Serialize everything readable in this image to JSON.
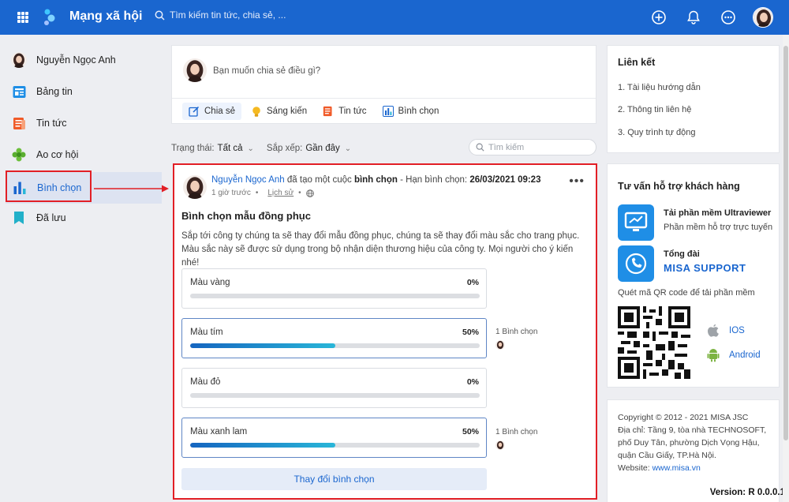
{
  "topbar": {
    "title": "Mạng xã hội",
    "search_placeholder": "Tìm kiếm tin tức, chia sẻ, ..."
  },
  "sidebar": {
    "user_name": "Nguyễn Ngọc Anh",
    "items": [
      {
        "label": "Bảng tin",
        "icon": "newsfeed-icon"
      },
      {
        "label": "Tin tức",
        "icon": "news-icon"
      },
      {
        "label": "Ao cơ hội",
        "icon": "opportunity-icon"
      },
      {
        "label": "Bình chọn",
        "icon": "poll-icon",
        "active": true
      },
      {
        "label": "Đã lưu",
        "icon": "bookmark-icon"
      }
    ]
  },
  "composer": {
    "placeholder": "Bạn muốn chia sẻ điều gì?",
    "actions": [
      "Chia sẻ",
      "Sáng kiến",
      "Tin tức",
      "Bình chọn"
    ]
  },
  "filters": {
    "status_label": "Trạng thái:",
    "status_value": "Tất cả",
    "sort_label": "Sắp xếp:",
    "sort_value": "Gần đây",
    "search_placeholder": "Tìm kiếm"
  },
  "post": {
    "author": "Nguyễn Ngọc Anh",
    "action": "đã tạo một cuộc",
    "type": "bình chọn",
    "deadline_label": "- Hạn bình chọn:",
    "deadline": "26/03/2021 09:23",
    "time": "1 giờ trước",
    "history": "Lịch sử",
    "dot": "•",
    "more": "•••",
    "title": "Bình chọn mẫu đồng phục",
    "description": "Sắp tới công ty chúng ta sẽ thay đổi mẫu đồng phục, chúng ta sẽ thay đổi màu sắc cho trang phục. Màu sắc này sẽ được sử dụng trong bộ nhận diện thương hiệu của công ty. Mọi người cho ý kiến nhé!",
    "options": [
      {
        "label": "Màu vàng",
        "percent": "0%",
        "fraction": 0,
        "voted": false,
        "votes": ""
      },
      {
        "label": "Màu tím",
        "percent": "50%",
        "fraction": 0.5,
        "voted": true,
        "votes": "1 Bình chọn"
      },
      {
        "label": "Màu đỏ",
        "percent": "0%",
        "fraction": 0,
        "voted": false,
        "votes": ""
      },
      {
        "label": "Màu xanh lam",
        "percent": "50%",
        "fraction": 0.5,
        "voted": true,
        "votes": "1 Bình chọn"
      }
    ],
    "change_button": "Thay đổi bình chọn"
  },
  "links": {
    "title": "Liên kết",
    "items": [
      "1. Tài liệu hướng dẫn",
      "2. Thông tin liên hệ",
      "3. Quy trình tự động"
    ]
  },
  "support": {
    "title": "Tư vấn hỗ trợ khách hàng",
    "ultraviewer_title": "Tải phần mềm Ultraviewer",
    "ultraviewer_sub": "Phần mềm hỗ trợ trực tuyến",
    "hotline_title": "Tổng đài",
    "hotline_name": "MISA SUPPORT",
    "qr_caption": "Quét mã QR code để tải phần mềm",
    "ios": "IOS",
    "android": "Android"
  },
  "footer": {
    "copyright": "Copyright © 2012 - 2021 MISA JSC",
    "address": "Địa chỉ: Tầng 9, tòa nhà TECHNOSOFT, phố Duy Tân, phường Dịch Vọng Hậu, quận Cầu Giấy, TP.Hà Nội.",
    "website_label": "Website:",
    "website": "www.misa.vn",
    "version": "Version: R 0.0.0.1"
  },
  "colors": {
    "brand": "#1a66cf",
    "highlight": "#e21f26"
  }
}
